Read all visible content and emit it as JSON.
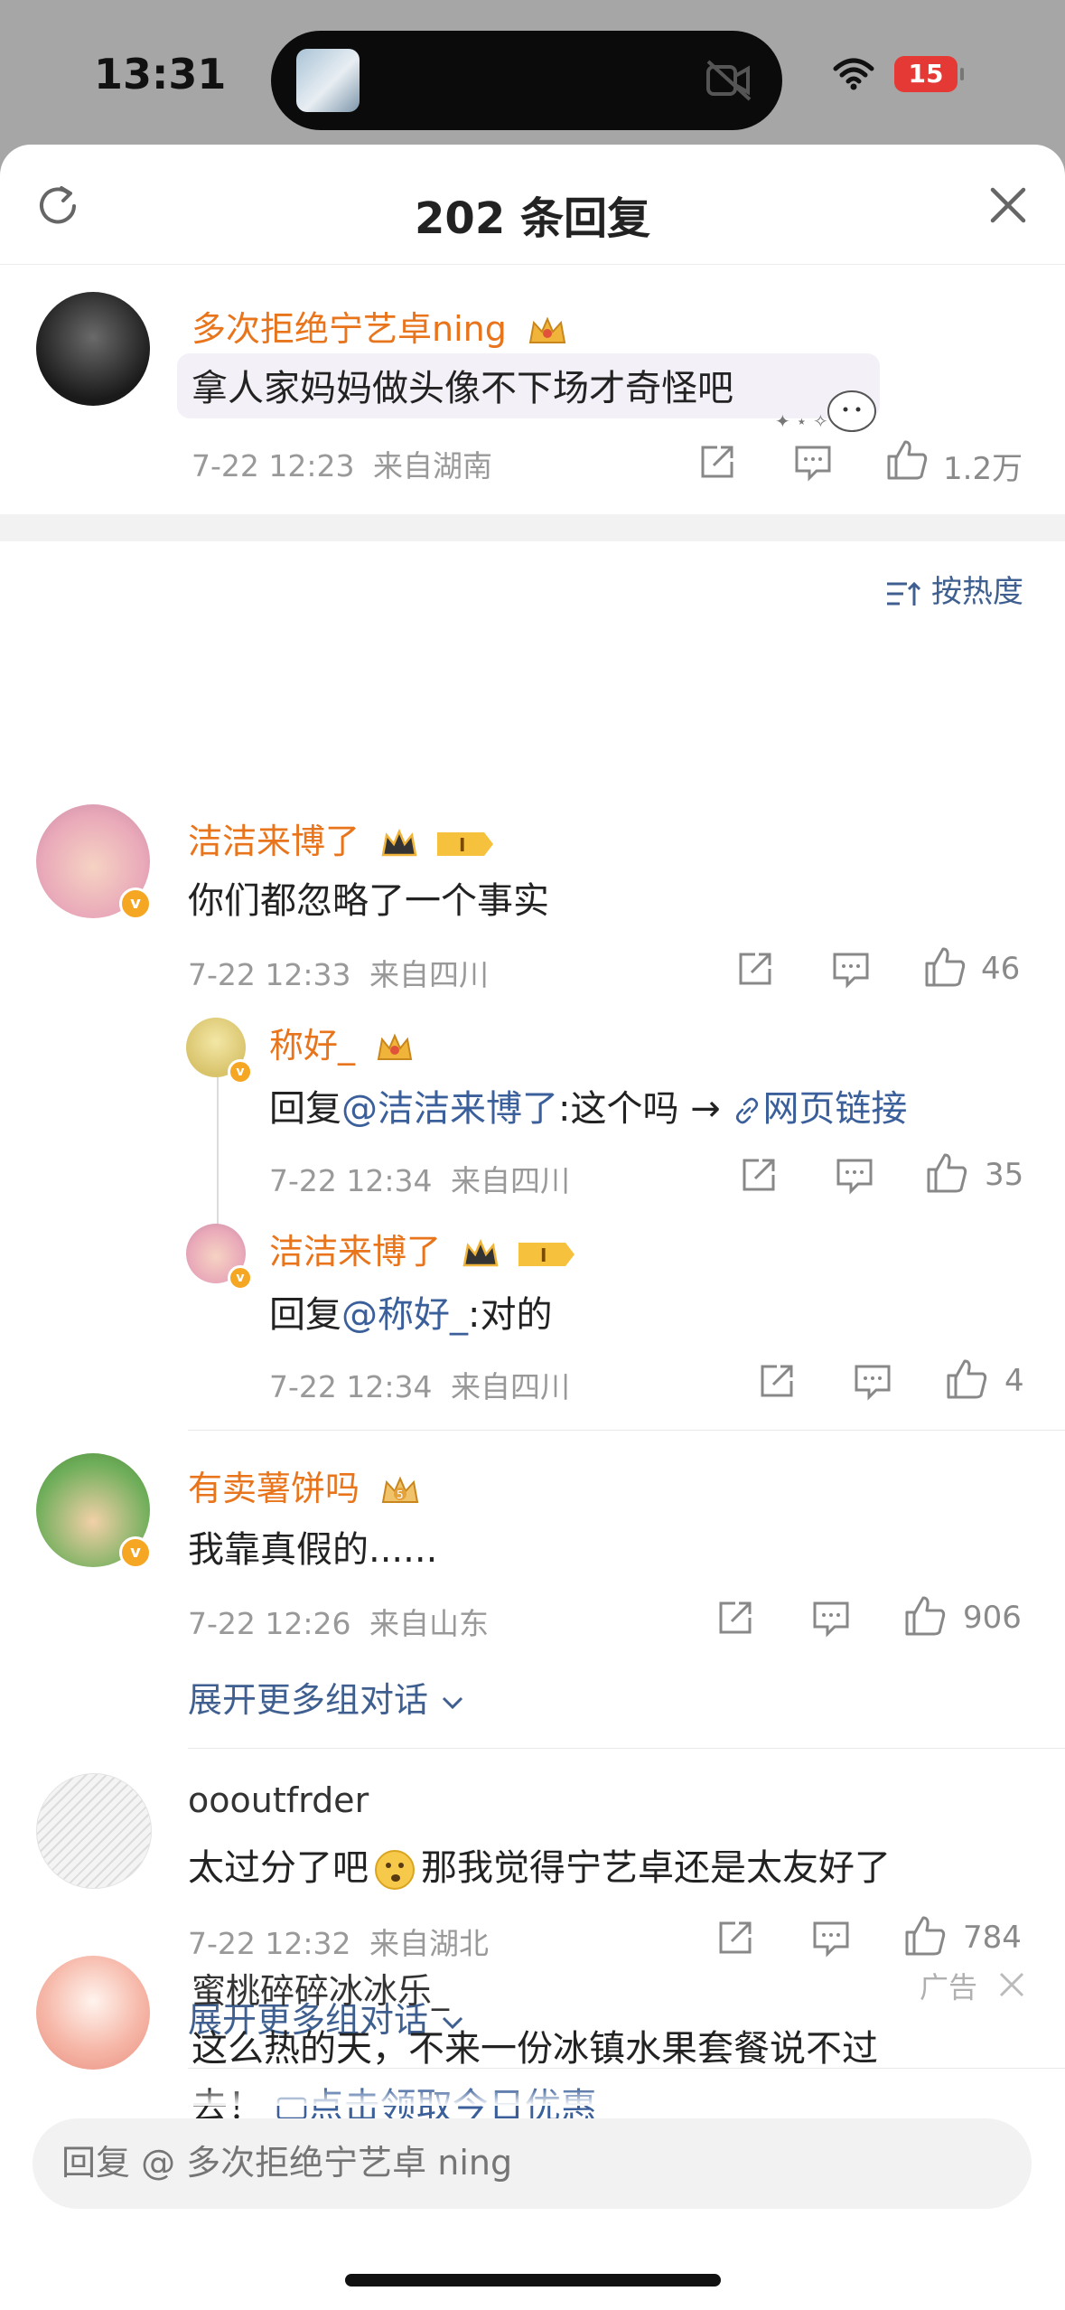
{
  "status_bar": {
    "time": "13:31",
    "battery": "15"
  },
  "header": {
    "title": "202 条回复"
  },
  "root_comment": {
    "username": "多次拒绝宁艺卓ning",
    "text": "拿人家妈妈做头像不下场才奇怪吧",
    "time": "7-22 12:23",
    "location": "来自湖南",
    "likes": "1.2万"
  },
  "sort": {
    "label": "按热度"
  },
  "comments": [
    {
      "username": "洁洁来博了",
      "text": "你们都忽略了一个事实",
      "time": "7-22 12:33",
      "location": "来自四川",
      "likes": "46",
      "replies": [
        {
          "username": "称好_",
          "reply_prefix": "回复",
          "mention": "@洁洁来博了",
          "text_suffix": ":这个吗 →",
          "link_text": "网页链接",
          "time": "7-22 12:34",
          "location": "来自四川",
          "likes": "35"
        },
        {
          "username": "洁洁来博了",
          "reply_prefix": "回复",
          "mention": "@称好_",
          "text_suffix": ":对的",
          "time": "7-22 12:34",
          "location": "来自四川",
          "likes": "4"
        }
      ]
    },
    {
      "username": "有卖薯饼吗",
      "text": "我靠真假的......",
      "time": "7-22 12:26",
      "location": "来自山东",
      "likes": "906",
      "expand": "展开更多组对话"
    },
    {
      "username": "oooutfrder",
      "text_before": "太过分了吧",
      "text_after": "那我觉得宁艺卓还是太友好了",
      "time": "7-22 12:32",
      "location": "来自湖北",
      "likes": "784",
      "expand": "展开更多组对话"
    }
  ],
  "ad": {
    "username": "蜜桃碎碎冰冰乐_",
    "tag": "广告",
    "line1": "这么热的天，不来一份冰镇水果套餐说不过",
    "line2_prefix": "去！",
    "link_text": "点击领取今日优惠"
  },
  "input": {
    "placeholder": "回复 @ 多次拒绝宁艺卓 ning"
  },
  "colors": {
    "username": "#e8741c",
    "link": "#3a5f9a",
    "sheet": "#ffffff",
    "backdrop": "#a6a6a6"
  }
}
